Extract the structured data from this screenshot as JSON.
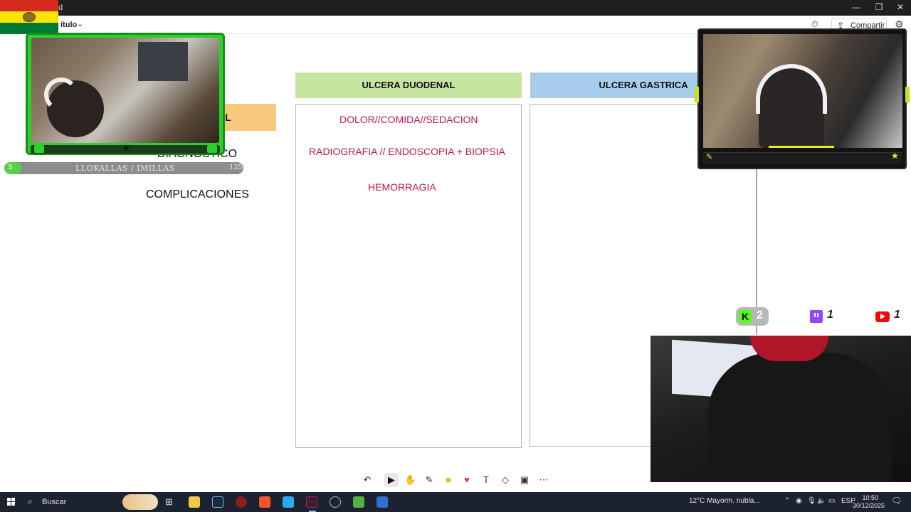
{
  "window": {
    "title_fragment": "d",
    "doc_title": "ítulo"
  },
  "toolbar": {
    "share_label": "Compartir"
  },
  "whiteboard": {
    "columns": [
      {
        "header": "ULCERA DUODENAL",
        "color": "#c6e5a1",
        "entries": [
          "DOLOR//COMIDA//SEDACION",
          "RADIOGRAFIA // ENDOSCOPIA + BIOPSIA",
          "HEMORRAGIA"
        ]
      },
      {
        "header": "ULCERA GASTRICA",
        "color": "#a8cdec",
        "entries": []
      }
    ],
    "orange_label": "NAL",
    "row_labels": [
      "DIAGNOSTICO",
      "COMPLICACIONES"
    ],
    "text_color": "#c0184c"
  },
  "overlay": {
    "level": "5",
    "bar_label": "LLOKALLAS / IMILLAS",
    "goal": "125",
    "progress_fraction": 0.07
  },
  "counters": {
    "kick": "2",
    "twitch": "1",
    "youtube": "1"
  },
  "taskbar": {
    "search_label": "Buscar",
    "weather": "12°C  Mayorm. nubla...",
    "lang": "ESP",
    "time": "10:50",
    "date": "30/12/2025"
  }
}
